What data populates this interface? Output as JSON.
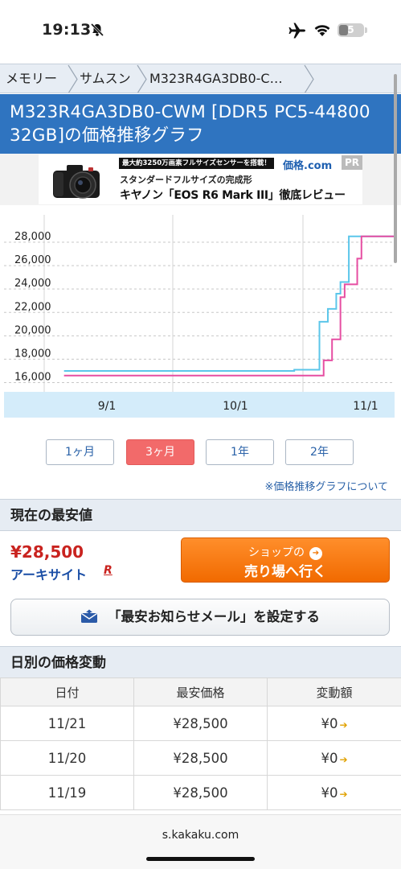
{
  "statusbar": {
    "time": "19:13",
    "battery": "5"
  },
  "breadcrumb": [
    "メモリー",
    "サムスン",
    "M323R4GA3DB0-C…"
  ],
  "page_title": "M323R4GA3DB0-CWM [DDR5 PC5-44800 32GB]の価格推移グラフ",
  "ad": {
    "tag": "最大約3250万画素フルサイズセンサーを搭載！",
    "sub": "スタンダードフルサイズの完成形",
    "main": "キヤノン「EOS R6 Mark III」徹底レビュー",
    "logo": "価格.com",
    "pr": "PR"
  },
  "chart_data": {
    "type": "line",
    "x_tick_labels": [
      "9/1",
      "10/1",
      "11/1"
    ],
    "y_ticks": [
      16000,
      18000,
      20000,
      22000,
      24000,
      26000,
      28000
    ],
    "y_tick_labels": [
      "16,000",
      "18,000",
      "20,000",
      "22,000",
      "24,000",
      "26,000",
      "28,000"
    ],
    "ylim": [
      16000,
      29000
    ],
    "grid": true,
    "series": [
      {
        "color": "#5bc6ea",
        "x": [
          "8/22",
          "9/1",
          "9/15",
          "10/1",
          "10/15",
          "10/20",
          "10/21",
          "10/22",
          "10/23",
          "10/24",
          "10/25",
          "10/26",
          "10/27",
          "10/28",
          "10/30",
          "11/1",
          "11/20"
        ],
        "values": [
          17000,
          17000,
          17000,
          17000,
          17100,
          17100,
          21200,
          21200,
          22300,
          22300,
          23600,
          24600,
          24600,
          28500,
          28500,
          28500,
          28500
        ]
      },
      {
        "color": "#e64ea2",
        "x": [
          "8/22",
          "9/1",
          "10/1",
          "10/20",
          "10/22",
          "10/23",
          "10/24",
          "10/25",
          "10/26",
          "10/27",
          "10/28",
          "10/29",
          "10/30",
          "10/31",
          "11/20"
        ],
        "values": [
          16600,
          16600,
          16600,
          16600,
          17900,
          17900,
          19700,
          19700,
          23300,
          24400,
          24400,
          24400,
          26600,
          28500,
          28500
        ]
      }
    ]
  },
  "range_tabs": [
    {
      "label": "1ヶ月",
      "active": false
    },
    {
      "label": "3ヶ月",
      "active": true
    },
    {
      "label": "1年",
      "active": false
    },
    {
      "label": "2年",
      "active": false
    }
  ],
  "graph_note": "※価格推移グラフについて",
  "lowest": {
    "heading": "現在の最安値",
    "price": "¥28,500",
    "shop": "アーキサイト",
    "shop_mark": "R",
    "button_line1": "ショップの",
    "button_line2": "売り場へ行く"
  },
  "mail_button": "「最安お知らせメール」を設定する",
  "daily": {
    "heading": "日別の価格変動",
    "columns": [
      "日付",
      "最安価格",
      "変動額"
    ],
    "rows": [
      [
        "11/21",
        "¥28,500",
        "¥0"
      ],
      [
        "11/20",
        "¥28,500",
        "¥0"
      ],
      [
        "11/19",
        "¥28,500",
        "¥0"
      ]
    ]
  },
  "browser": {
    "url": "s.kakaku.com"
  }
}
